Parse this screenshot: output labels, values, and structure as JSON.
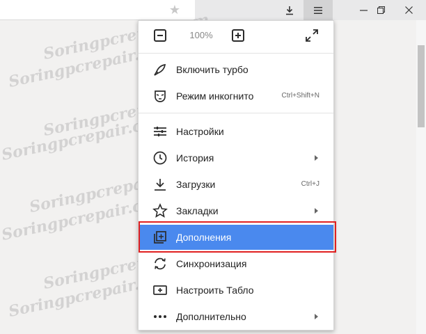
{
  "toolbar": {
    "bookmark_icon": "star-icon",
    "download_icon": "download-icon",
    "menu_icon": "hamburger-menu-icon",
    "window_controls": [
      "minimize-icon",
      "maximize-icon",
      "close-icon"
    ]
  },
  "watermark": "Soringpcrepair.com",
  "menu": {
    "zoom": {
      "value": "100%",
      "minus_icon": "zoom-out-icon",
      "plus_icon": "zoom-in-icon",
      "fullscreen_icon": "fullscreen-icon"
    },
    "items": [
      {
        "label": "Включить турбо",
        "icon": "rocket-icon",
        "shortcut": "",
        "submenu": false
      },
      {
        "label": "Режим инкогнито",
        "icon": "incognito-mask-icon",
        "shortcut": "Ctrl+Shift+N",
        "submenu": false
      },
      {
        "label": "Настройки",
        "icon": "settings-sliders-icon",
        "shortcut": "",
        "submenu": false
      },
      {
        "label": "История",
        "icon": "clock-icon",
        "shortcut": "",
        "submenu": true
      },
      {
        "label": "Загрузки",
        "icon": "download-icon",
        "shortcut": "Ctrl+J",
        "submenu": false
      },
      {
        "label": "Закладки",
        "icon": "star-icon",
        "shortcut": "",
        "submenu": true
      },
      {
        "label": "Дополнения",
        "icon": "extensions-icon",
        "shortcut": "",
        "submenu": false,
        "selected": true
      },
      {
        "label": "Синхронизация",
        "icon": "sync-icon",
        "shortcut": "",
        "submenu": false
      },
      {
        "label": "Настроить Табло",
        "icon": "add-tile-icon",
        "shortcut": "",
        "submenu": false
      },
      {
        "label": "Дополнительно",
        "icon": "more-dots-icon",
        "shortcut": "",
        "submenu": true
      }
    ]
  },
  "colors": {
    "selected_bg": "#4a89ee",
    "highlight_frame": "#e02020"
  }
}
